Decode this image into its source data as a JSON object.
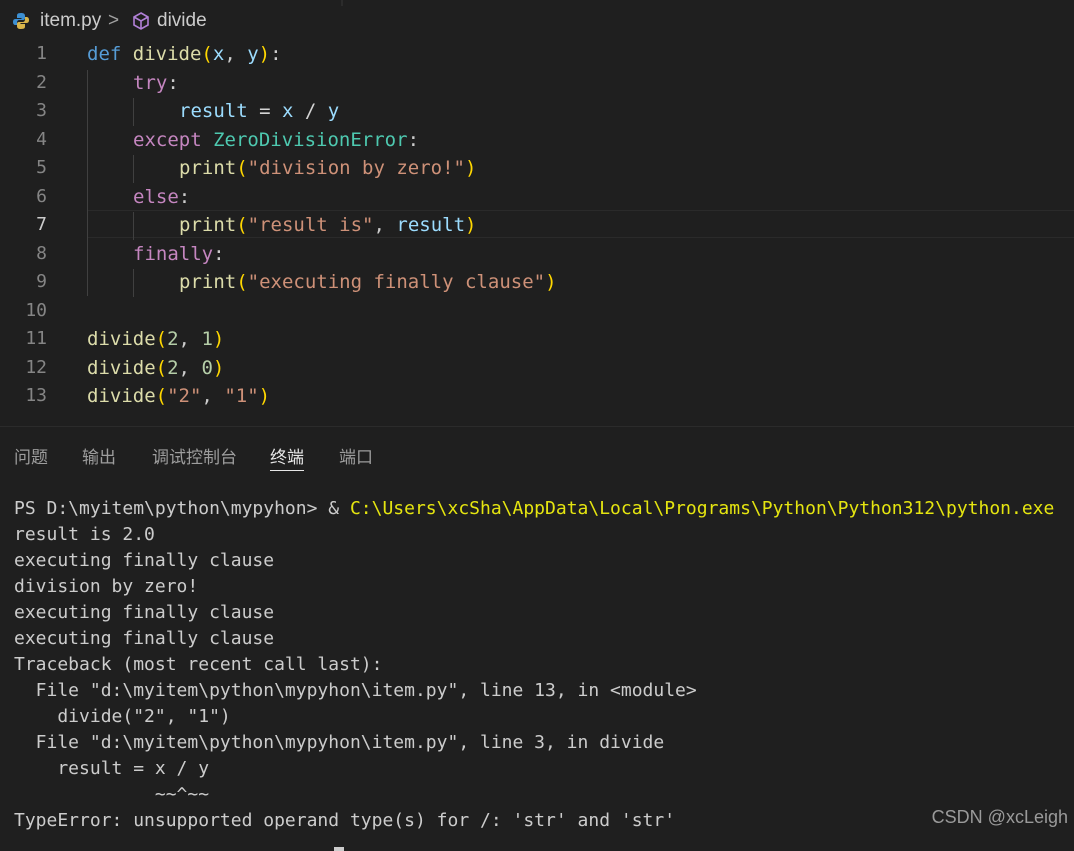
{
  "breadcrumb": {
    "file": "item.py",
    "separator": ">",
    "symbol": "divide"
  },
  "editor": {
    "line_numbers": [
      "1",
      "2",
      "3",
      "4",
      "5",
      "6",
      "7",
      "8",
      "9",
      "10",
      "11",
      "12",
      "13"
    ],
    "active_line": "7",
    "code": {
      "l1": {
        "def": "def",
        "name": "divide",
        "open": "(",
        "x": "x",
        "comma": ", ",
        "y": "y",
        "close": ")",
        "colon": ":"
      },
      "l2": {
        "kw": "try",
        "colon": ":"
      },
      "l3": {
        "result": "result",
        "eq": " = ",
        "x": "x",
        "div": " / ",
        "y": "y"
      },
      "l4": {
        "kw": "except",
        "sp": " ",
        "cls": "ZeroDivisionError",
        "colon": ":"
      },
      "l5": {
        "fn": "print",
        "open": "(",
        "str": "\"division by zero!\"",
        "close": ")"
      },
      "l6": {
        "kw": "else",
        "colon": ":"
      },
      "l7": {
        "fn": "print",
        "open": "(",
        "str": "\"result is\"",
        "comma": ", ",
        "var": "result",
        "close": ")"
      },
      "l8": {
        "kw": "finally",
        "colon": ":"
      },
      "l9": {
        "fn": "print",
        "open": "(",
        "str": "\"executing finally clause\"",
        "close": ")"
      },
      "l11": {
        "fn": "divide",
        "open": "(",
        "a": "2",
        "comma": ", ",
        "b": "1",
        "close": ")"
      },
      "l12": {
        "fn": "divide",
        "open": "(",
        "a": "2",
        "comma": ", ",
        "b": "0",
        "close": ")"
      },
      "l13": {
        "fn": "divide",
        "open": "(",
        "a": "\"2\"",
        "comma": ", ",
        "b": "\"1\"",
        "close": ")"
      }
    }
  },
  "panel": {
    "tabs": [
      "问题",
      "输出",
      "调试控制台",
      "终端",
      "端口"
    ],
    "active_tab": "终端"
  },
  "terminal": {
    "prompt": "PS D:\\myitem\\python\\mypyhon> & ",
    "command": "C:\\Users\\xcSha\\AppData\\Local\\Programs\\Python\\Python312\\python.exe",
    "lines": [
      "result is 2.0",
      "executing finally clause",
      "division by zero!",
      "executing finally clause",
      "executing finally clause",
      "Traceback (most recent call last):",
      "  File \"d:\\myitem\\python\\mypyhon\\item.py\", line 13, in <module>",
      "    divide(\"2\", \"1\")",
      "  File \"d:\\myitem\\python\\mypyhon\\item.py\", line 3, in divide",
      "    result = x / y",
      "             ~~^~~",
      "TypeError: unsupported operand type(s) for /: 'str' and 'str'"
    ]
  },
  "watermark": "CSDN @xcLeigh"
}
